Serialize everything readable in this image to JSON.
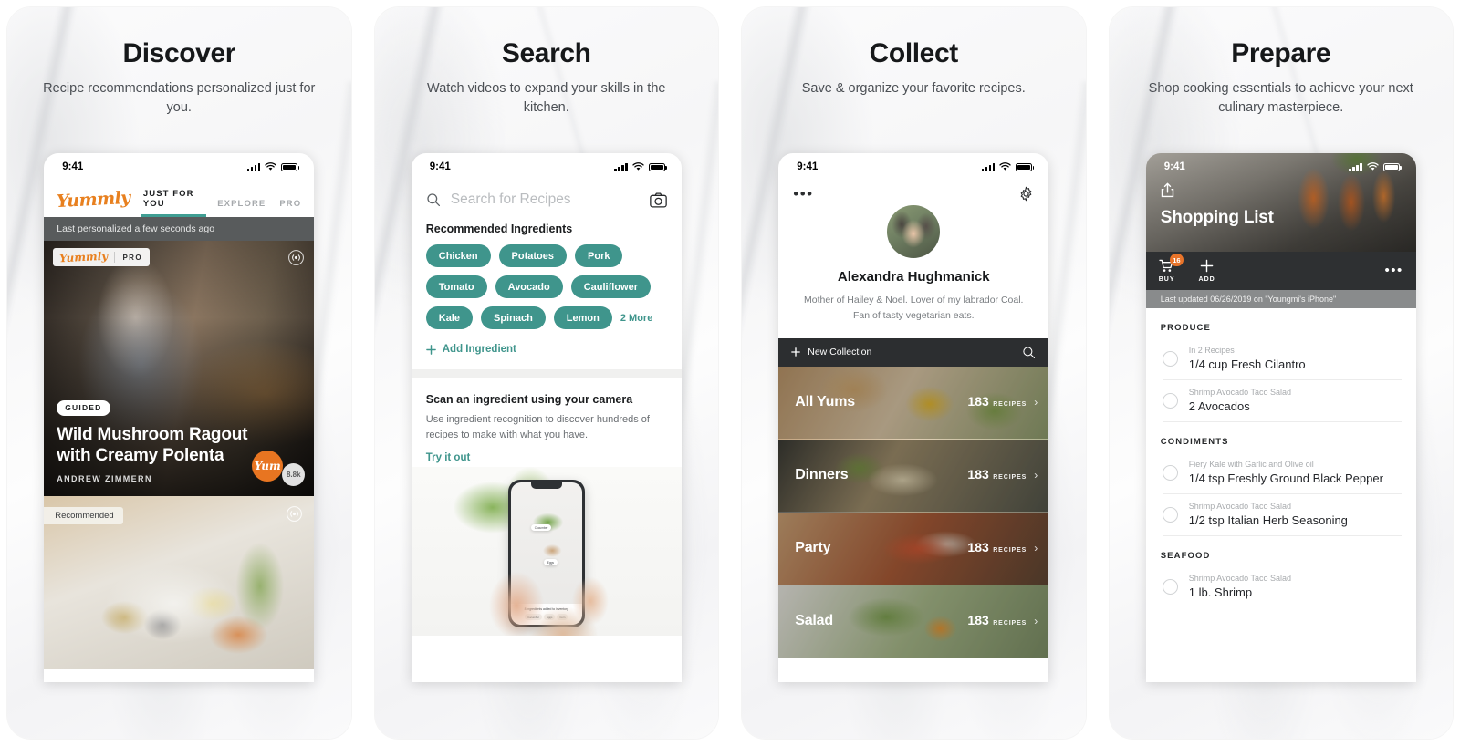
{
  "panels": [
    {
      "title": "Discover",
      "subtitle": "Recipe recommendations personalized just for you."
    },
    {
      "title": "Search",
      "subtitle": "Watch videos to expand your skills in the kitchen."
    },
    {
      "title": "Collect",
      "subtitle": "Save & organize your favorite recipes."
    },
    {
      "title": "Prepare",
      "subtitle": "Shop cooking essentials to achieve your next culinary masterpiece."
    }
  ],
  "status_bar": {
    "time": "9:41"
  },
  "discover": {
    "brand": "Yummly",
    "tabs": [
      {
        "label": "JUST FOR YOU",
        "active": true
      },
      {
        "label": "EXPLORE",
        "active": false
      },
      {
        "label": "PRO",
        "active": false
      }
    ],
    "personalized_note": "Last personalized a few seconds ago",
    "hero": {
      "pro_brand": "Yummly",
      "pro_label": "PRO",
      "badge": "GUIDED",
      "title_line1": "Wild Mushroom Ragout",
      "title_line2": "with Creamy Polenta",
      "author": "ANDREW ZIMMERN",
      "yum_label": "Yum",
      "yum_count": "8.8k"
    },
    "second_card": {
      "badge": "Recommended"
    }
  },
  "search": {
    "placeholder": "Search for Recipes",
    "section_title": "Recommended Ingredients",
    "ingredients": [
      "Chicken",
      "Potatoes",
      "Pork",
      "Tomato",
      "Avocado",
      "Cauliflower",
      "Kale",
      "Spinach",
      "Lemon"
    ],
    "more_label": "2 More",
    "add_ingredient": "Add Ingredient",
    "scan": {
      "title": "Scan an ingredient using your camera",
      "description": "Use ingredient recognition to discover hundreds of recipes to make with what you have.",
      "cta": "Try it out",
      "mini_phone": {
        "tag1": "Cucumber",
        "tag2": "Eggs",
        "footer": "8 ingredients added to inventory",
        "chips": [
          "Cucumber",
          "Eggs",
          "Corn"
        ]
      }
    }
  },
  "collect": {
    "profile": {
      "name": "Alexandra Hughmanick",
      "bio": "Mother of Hailey & Noel. Lover of my labrador Coal. Fan of tasty vegetarian eats."
    },
    "new_collection_label": "New Collection",
    "collections": [
      {
        "name": "All Yums",
        "count": "183",
        "unit": "RECIPES"
      },
      {
        "name": "Dinners",
        "count": "183",
        "unit": "RECIPES"
      },
      {
        "name": "Party",
        "count": "183",
        "unit": "RECIPES"
      },
      {
        "name": "Salad",
        "count": "183",
        "unit": "RECIPES"
      }
    ]
  },
  "prepare": {
    "title": "Shopping List",
    "actions": [
      {
        "label": "BUY",
        "badge": "16"
      },
      {
        "label": "ADD",
        "badge": ""
      }
    ],
    "updated": "Last updated 06/26/2019 on \"Youngmi's iPhone\"",
    "categories": [
      {
        "name": "PRODUCE",
        "items": [
          {
            "source": "In 2 Recipes",
            "name": "1/4 cup Fresh Cilantro"
          },
          {
            "source": "Shrimp Avocado Taco Salad",
            "name": "2 Avocados"
          }
        ]
      },
      {
        "name": "CONDIMENTS",
        "items": [
          {
            "source": "Fiery Kale with Garlic and Olive oil",
            "name": "1/4 tsp Freshly Ground Black Pepper"
          },
          {
            "source": "Shrimp Avocado Taco Salad",
            "name": "1/2 tsp Italian Herb Seasoning"
          }
        ]
      },
      {
        "name": "SEAFOOD",
        "items": [
          {
            "source": "Shrimp Avocado Taco Salad",
            "name": "1 lb. Shrimp"
          }
        ]
      }
    ]
  },
  "colors": {
    "brand_orange": "#e8801f",
    "teal": "#3f958c",
    "dark": "#2c2e30"
  }
}
